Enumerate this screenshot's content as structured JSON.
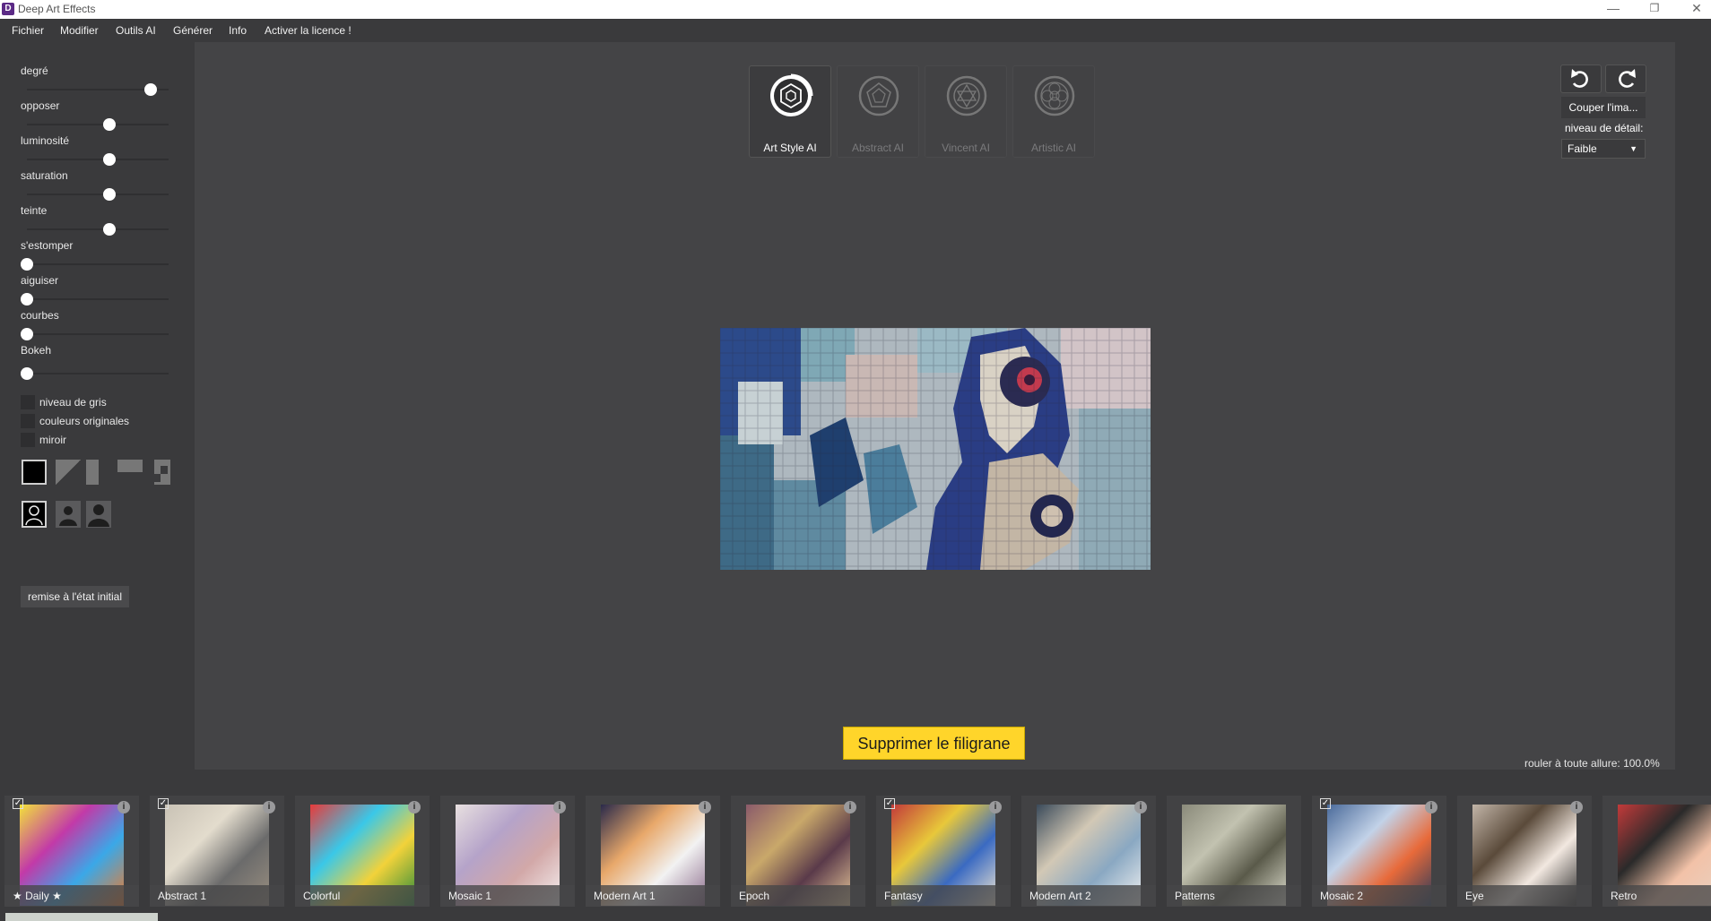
{
  "window": {
    "title": "Deep Art Effects",
    "icon_letter": "D",
    "minimize": "—",
    "maximize": "❐",
    "close": "✕"
  },
  "menu": [
    "Fichier",
    "Modifier",
    "Outils AI",
    "Générer",
    "Info",
    "Activer la licence !"
  ],
  "sliders": [
    {
      "label": "degré",
      "value": 0.75
    },
    {
      "label": "opposer",
      "value": 0.5
    },
    {
      "label": "luminosité",
      "value": 0.5
    },
    {
      "label": "saturation",
      "value": 0.5
    },
    {
      "label": "teinte",
      "value": 0.5
    },
    {
      "label": "s'estomper",
      "value": 0
    },
    {
      "label": "aiguiser",
      "value": 0
    },
    {
      "label": "courbes",
      "value": 0
    },
    {
      "label": "Bokeh",
      "value": 0
    }
  ],
  "checkboxes": [
    {
      "label": "niveau de gris",
      "checked": false
    },
    {
      "label": "couleurs originales",
      "checked": false
    },
    {
      "label": "miroir",
      "checked": false
    }
  ],
  "reset_label": "remise à l'état initial",
  "ai_tools": [
    {
      "label": "Art Style AI",
      "active": true
    },
    {
      "label": "Abstract AI",
      "active": false
    },
    {
      "label": "Vincent AI",
      "active": false
    },
    {
      "label": "Artistic AI",
      "active": false
    }
  ],
  "crop_label": "Couper l'ima...",
  "detail": {
    "label": "niveau de détail:",
    "value": "Faible"
  },
  "watermark_label": "Supprimer le filigrane",
  "status": "rouler à toute allure: 100.0%",
  "styles": [
    {
      "name": "★ Daily ★",
      "checked": true,
      "info": true
    },
    {
      "name": "Abstract 1",
      "checked": true,
      "info": true
    },
    {
      "name": "Colorful",
      "checked": false,
      "info": true
    },
    {
      "name": "Mosaic 1",
      "checked": false,
      "info": true
    },
    {
      "name": "Modern Art 1",
      "checked": false,
      "info": true
    },
    {
      "name": "Epoch",
      "checked": false,
      "info": true
    },
    {
      "name": "Fantasy",
      "checked": true,
      "info": true
    },
    {
      "name": "Modern Art 2",
      "checked": false,
      "info": true
    },
    {
      "name": "Patterns",
      "checked": false,
      "info": false
    },
    {
      "name": "Mosaic 2",
      "checked": true,
      "info": true
    },
    {
      "name": "Eye",
      "checked": false,
      "info": true
    },
    {
      "name": "Retro",
      "checked": false,
      "info": false
    }
  ],
  "colors": {
    "accent_yellow": "#ffd52a",
    "background": "#3a3a3c",
    "canvas": "#444446"
  }
}
